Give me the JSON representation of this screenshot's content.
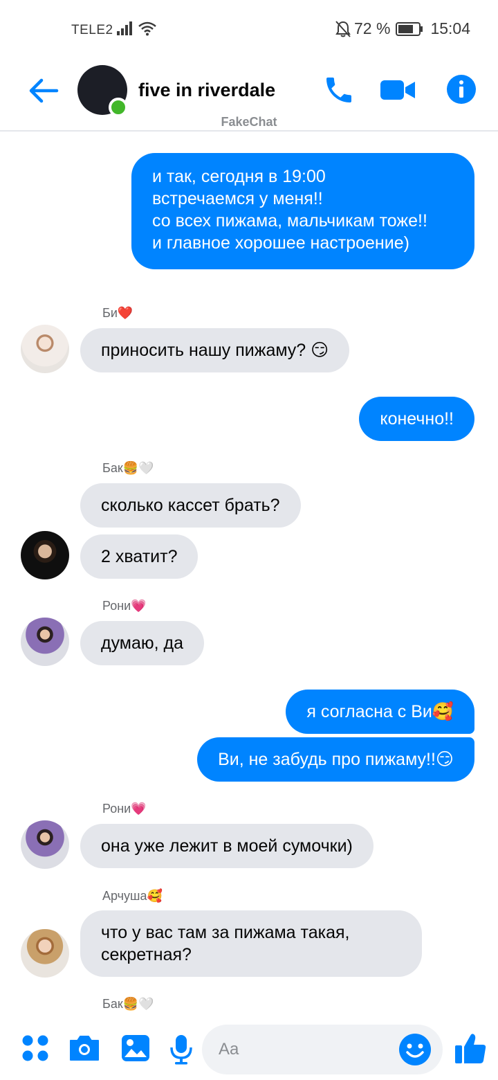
{
  "status_bar": {
    "carrier": "TELE2",
    "battery_percent": "72 %",
    "time": "15:04"
  },
  "header": {
    "title": "five in riverdale",
    "watermark": "FakeChat",
    "icons": [
      "back-arrow-icon",
      "phone-icon",
      "video-camera-icon",
      "info-icon"
    ]
  },
  "messages": [
    {
      "type": "outgoing",
      "text": "и так, сегодня в 19:00\nвстречаемся у меня!!\nсо всех пижама, мальчикам тоже!!\nи главное хорошее настроение)"
    },
    {
      "type": "sender",
      "text": "Би❤️"
    },
    {
      "type": "incoming",
      "text": "приносить нашу пижаму? 😏"
    },
    {
      "type": "outgoing",
      "text": "конечно!!"
    },
    {
      "type": "sender",
      "text": "Бак🍔🤍"
    },
    {
      "type": "incoming",
      "text": "сколько кассет брать?"
    },
    {
      "type": "incoming",
      "text": "2 хватит?"
    },
    {
      "type": "sender",
      "text": "Рони💗"
    },
    {
      "type": "incoming",
      "text": "думаю, да"
    },
    {
      "type": "outgoing",
      "text": "я согласна с Ви🥰"
    },
    {
      "type": "outgoing",
      "text": "Ви, не забудь про пижаму!!😏"
    },
    {
      "type": "sender",
      "text": "Рони💗"
    },
    {
      "type": "incoming",
      "text": "она уже лежит в моей сумочки)"
    },
    {
      "type": "sender",
      "text": "Арчуша🥰"
    },
    {
      "type": "incoming",
      "text": "что у вас там за пижама такая, секретная?"
    },
    {
      "type": "sender",
      "text": "Бак🍔🤍"
    }
  ],
  "composer": {
    "placeholder": "Aa",
    "icons": [
      "apps-icon",
      "camera-icon",
      "gallery-icon",
      "microphone-icon",
      "emoji-icon",
      "thumbs-up-icon"
    ]
  },
  "colors": {
    "accent": "#0084ff",
    "incoming_bubble": "#e4e6eb",
    "online": "#42b72a"
  }
}
